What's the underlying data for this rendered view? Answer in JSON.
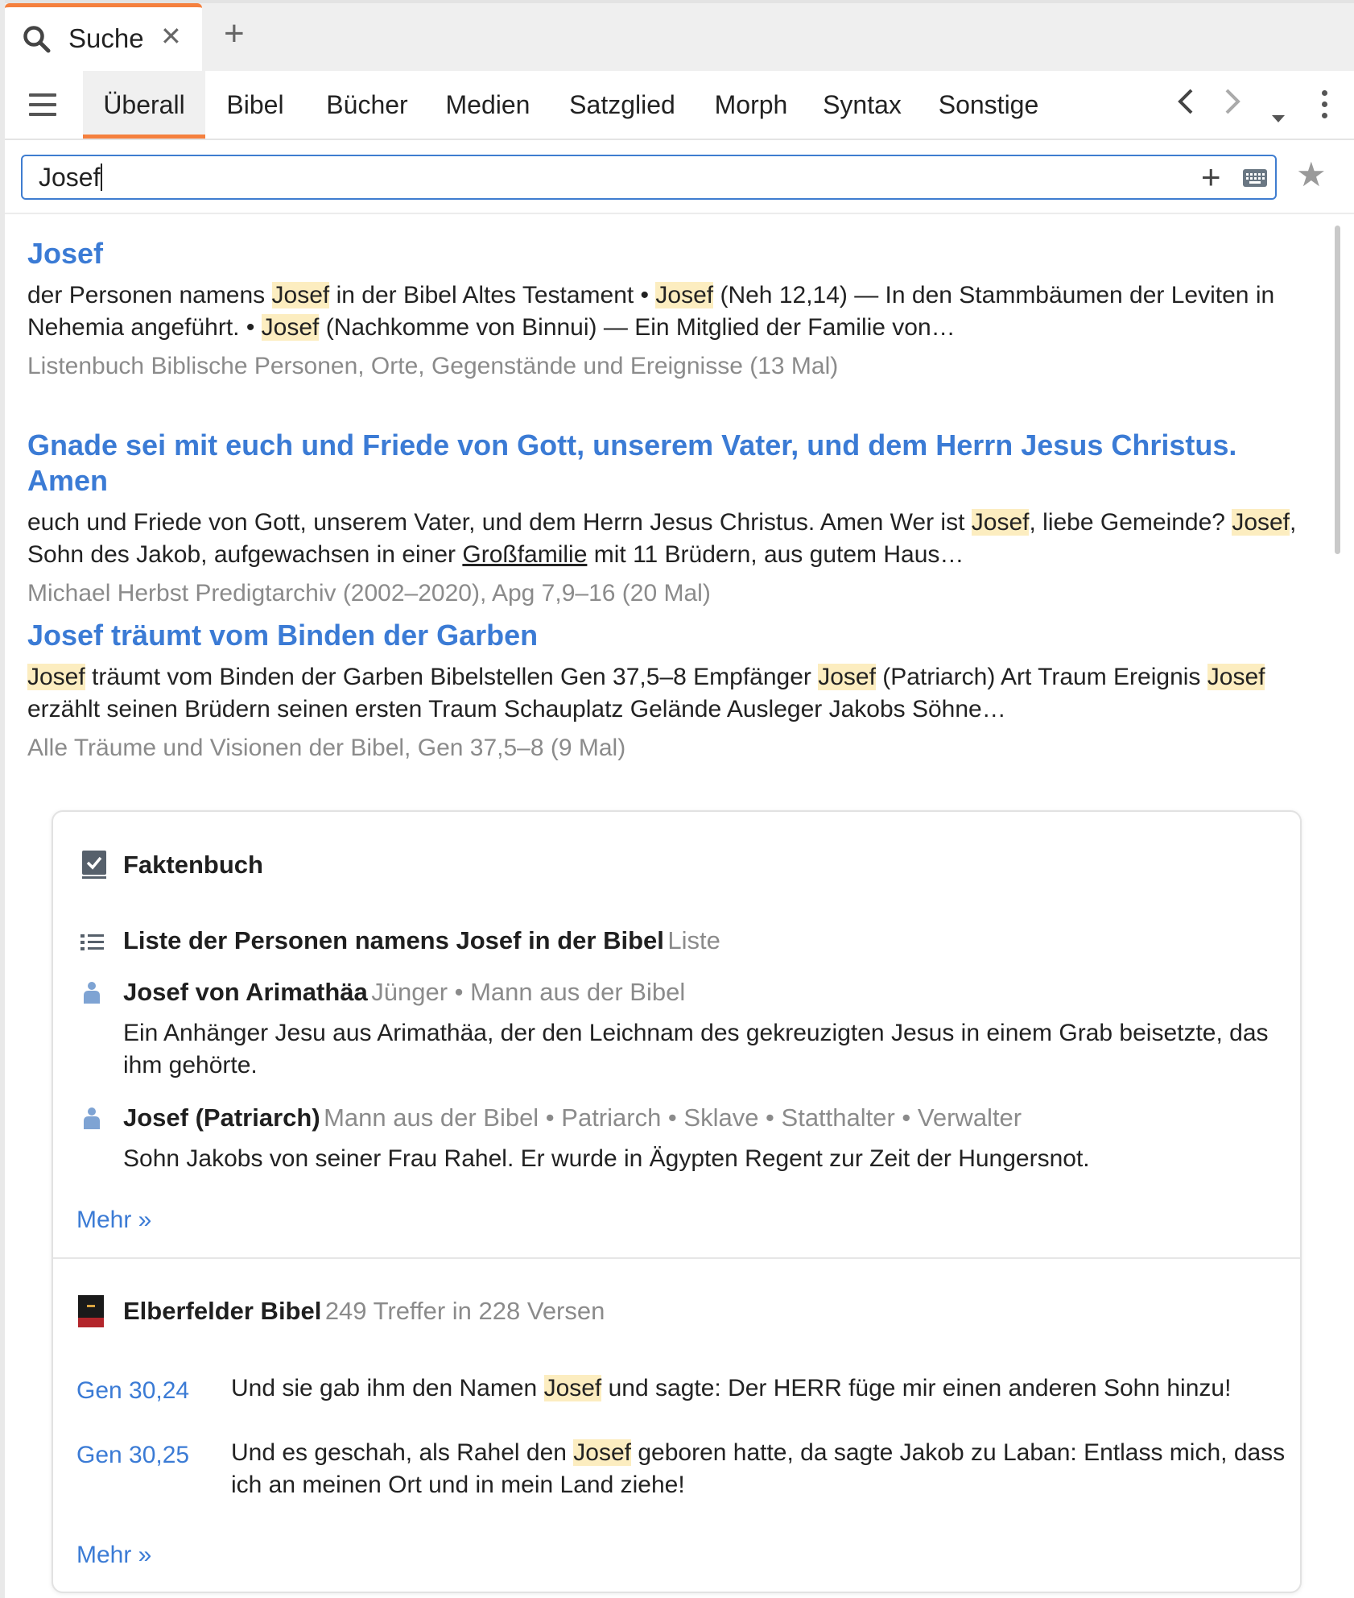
{
  "tab": {
    "title": "Suche",
    "close": "✕",
    "new": "+"
  },
  "toolbar": {
    "tabs": [
      "Überall",
      "Bibel",
      "Bücher",
      "Medien",
      "Satzglied",
      "Morph",
      "Syntax",
      "Sonstige"
    ],
    "active": "Überall",
    "back": "‹",
    "forward": "›",
    "dropdown": "▾"
  },
  "search": {
    "value": "Josef",
    "add": "+"
  },
  "results": [
    {
      "title": "Josef",
      "snippet": [
        {
          "t": "der Personen namens "
        },
        {
          "t": "Josef",
          "h": true
        },
        {
          "t": " in der Bibel Altes Testament • "
        },
        {
          "t": "Josef",
          "h": true
        },
        {
          "t": " (Neh 12,14) — In den Stammbäumen der Leviten in Nehemia angeführt. • "
        },
        {
          "t": "Josef",
          "h": true
        },
        {
          "t": " (Nachkomme von Binnui) — Ein Mitglied der Familie von…"
        }
      ],
      "meta": "Listenbuch Biblische Personen, Orte, Gegenstände und Ereignisse (13 Mal)"
    },
    {
      "title": "Gnade sei mit euch und Friede von Gott, unserem Vater, und dem Herrn Jesus Christus. Amen",
      "snippet": [
        {
          "t": "euch und Friede von Gott, unserem Vater, und dem Herrn Jesus Christus. Amen Wer ist "
        },
        {
          "t": "Josef",
          "h": true
        },
        {
          "t": ", liebe Gemeinde? "
        },
        {
          "t": "Josef",
          "h": true
        },
        {
          "t": ", Sohn des Jakob, aufgewachsen in einer "
        },
        {
          "t": "Großfamilie",
          "u": true
        },
        {
          "t": " mit 11 Brüdern, aus gutem Haus…"
        }
      ],
      "meta": "Michael Herbst Predigtarchiv (2002–2020), Apg 7,9–16 (20 Mal)"
    },
    {
      "title": "Josef träumt vom Binden der Garben",
      "snippet": [
        {
          "t": "Josef",
          "h": true
        },
        {
          "t": " träumt vom Binden der Garben Bibelstellen Gen 37,5–8 Empfänger "
        },
        {
          "t": "Josef",
          "h": true
        },
        {
          "t": " (Patriarch) Art Traum Ereignis "
        },
        {
          "t": "Josef",
          "h": true
        },
        {
          "t": " erzählt seinen Brüdern seinen ersten Traum Schauplatz Gelände Ausleger Jakobs Söhne…"
        }
      ],
      "meta": "Alle Träume und Visionen der Bibel, Gen 37,5–8 (9 Mal)"
    }
  ],
  "factbook": {
    "title": "Faktenbuch",
    "list_item": {
      "title": "Liste der Personen namens Josef in der Bibel",
      "meta": "Liste"
    },
    "people": [
      {
        "title": "Josef von Arimathäa",
        "meta": "Jünger • Mann aus der Bibel",
        "desc": "Ein Anhänger Jesu aus Arimathäa, der den Leichnam des gekreuzigten Jesus in einem Grab beisetzte, das ihm gehörte."
      },
      {
        "title": "Josef (Patriarch)",
        "meta": "Mann aus der Bibel • Patriarch • Sklave • Statthalter • Verwalter",
        "desc": "Sohn Jakobs von seiner Frau Rahel. Er wurde in Ägypten Regent zur Zeit der Hungersnot."
      }
    ],
    "more": "Mehr »"
  },
  "bible": {
    "title": "Elberfelder Bibel",
    "meta": "249 Treffer in 228 Versen",
    "verses": [
      {
        "ref": "Gen 30,24",
        "text": [
          {
            "t": "Und sie gab ihm den Namen "
          },
          {
            "t": "Josef",
            "h": true
          },
          {
            "t": " und sagte: Der HERR füge mir einen anderen Sohn hinzu!"
          }
        ]
      },
      {
        "ref": "Gen 30,25",
        "text": [
          {
            "t": "Und es geschah, als Rahel den "
          },
          {
            "t": "Josef",
            "h": true
          },
          {
            "t": " geboren hatte, da sagte Jakob zu Laban: Entlass mich, dass ich an meinen Ort und in mein Land ziehe!"
          }
        ]
      }
    ],
    "more": "Mehr »"
  },
  "colors": {
    "accent": "#f5803e",
    "link": "#3b7bd5",
    "highlight": "#fcedc0"
  }
}
